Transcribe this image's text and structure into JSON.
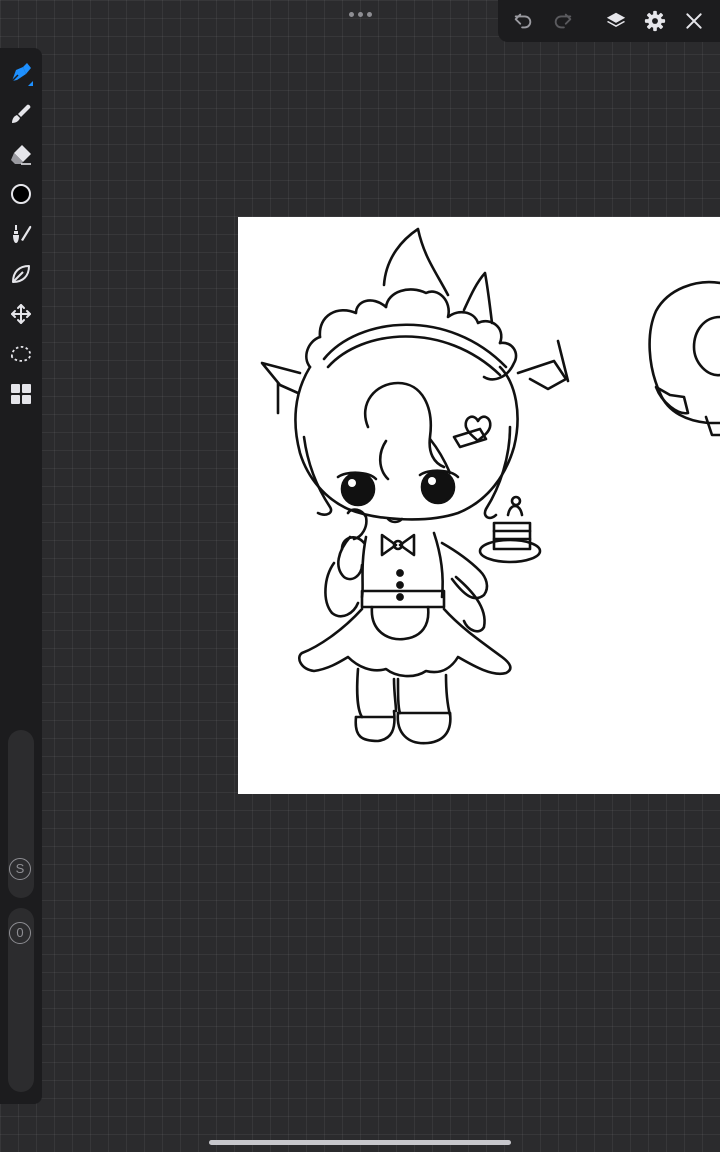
{
  "toolbar": {
    "undo_icon": "undo-icon",
    "redo_icon": "redo-icon",
    "layers_icon": "layers-icon",
    "settings_icon": "gear-icon",
    "close_icon": "close-icon",
    "more_icon": "more-dots-icon"
  },
  "sidebar": {
    "tools": [
      {
        "name": "pen-tool",
        "icon": "pen-icon",
        "active": true
      },
      {
        "name": "brush-tool",
        "icon": "brush-icon"
      },
      {
        "name": "eraser-tool",
        "icon": "eraser-icon"
      },
      {
        "name": "color-picker",
        "icon": "color-swatch-icon",
        "color": "#000000"
      },
      {
        "name": "smudge-tool",
        "icon": "smudge-icon"
      },
      {
        "name": "liquify-tool",
        "icon": "liquify-icon"
      },
      {
        "name": "transform-tool",
        "icon": "move-icon"
      },
      {
        "name": "lasso-tool",
        "icon": "lasso-icon"
      },
      {
        "name": "gallery-tool",
        "icon": "grid-icon"
      }
    ],
    "size_slider_label": "S",
    "opacity_slider_label": "0"
  },
  "colors": {
    "accent": "#1e90ff",
    "panel": "#1c1c1e",
    "canvas_bg": "#2b2b2d",
    "icon": "#e5e5ea"
  }
}
